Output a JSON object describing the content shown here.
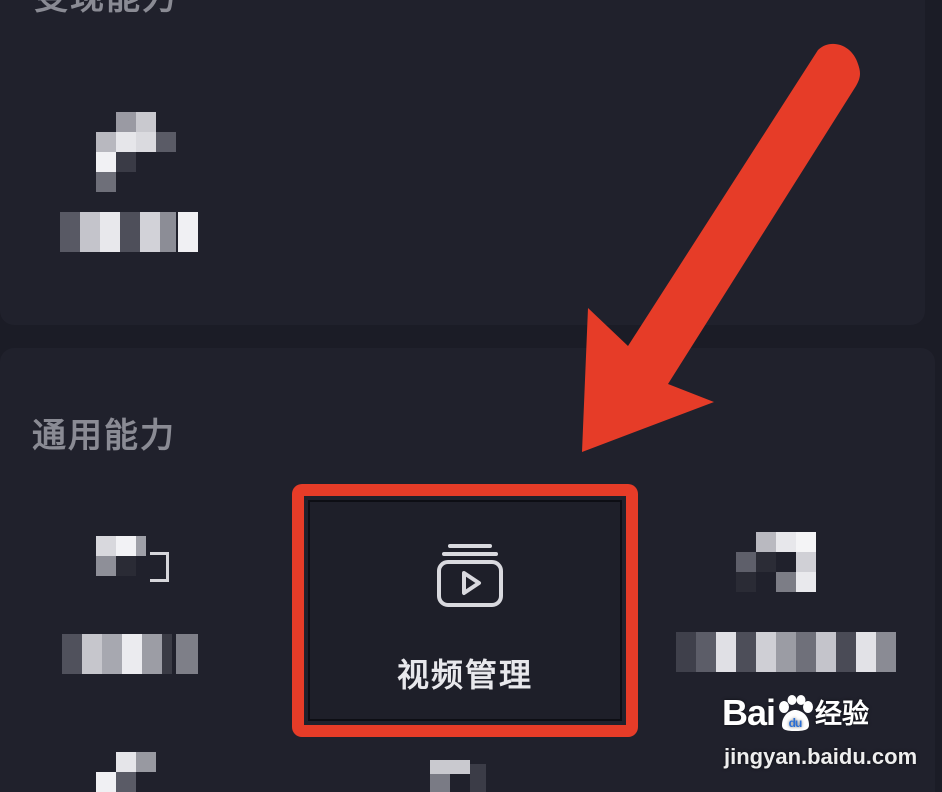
{
  "sections": {
    "monetization": {
      "title": "变现能力"
    },
    "general": {
      "title": "通用能力"
    }
  },
  "video_manage": {
    "label": "视频管理",
    "icon": "video-library-icon"
  },
  "annotation": {
    "arrow_color": "#e63c28",
    "highlight_color": "#e63c28"
  },
  "watermark": {
    "brand_prefix": "Bai",
    "brand_suffix": "经验",
    "url": "jingyan.baidu.com"
  }
}
